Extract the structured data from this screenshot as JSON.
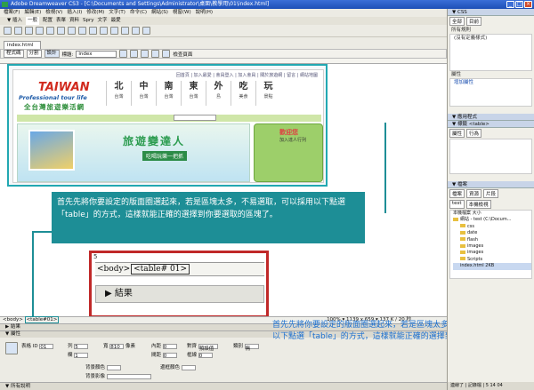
{
  "window": {
    "title": "Adobe Dreamweaver CS3 - [C:\\Documents and Settings\\Administrator\\桌面\\教學用\\01\\index.html]"
  },
  "menu": [
    "檔案(F)",
    "編輯(E)",
    "檢視(V)",
    "插入(I)",
    "修改(M)",
    "文字(T)",
    "命令(C)",
    "網站(S)",
    "視窗(W)",
    "說明(H)"
  ],
  "insert_tabs": [
    "一般",
    "配置",
    "表單",
    "資料",
    "Spry",
    "文字",
    "最愛"
  ],
  "insert_label": "▼ 插入",
  "document": {
    "tab": "index.html",
    "views": [
      "程式碼",
      "分割",
      "設計"
    ],
    "title_label": "標題:",
    "title_value": "index",
    "check_page": "檢查頁面"
  },
  "site": {
    "top_links": "回首頁 | 加入最愛 | 會員登入 | 加入會員 | 關於旅遊網 | 留言 | 網站地圖",
    "logo_en": "TAIWAN",
    "logo_sub": "Professional tour life",
    "logo_cn": "全台灣旅遊樂活網",
    "nav": [
      {
        "big": "北",
        "sm": "台灣"
      },
      {
        "big": "中",
        "sm": "台灣"
      },
      {
        "big": "南",
        "sm": "台灣"
      },
      {
        "big": "東",
        "sm": "台灣"
      },
      {
        "big": "外",
        "sm": "島"
      },
      {
        "big": "吃",
        "sm": "美食"
      },
      {
        "big": "玩",
        "sm": "景點"
      }
    ],
    "slogan": "旅遊變達人",
    "slogan_sub": "吃喝玩樂一把抓",
    "member_title": "歡迎您",
    "member_sub": "加入達人行列"
  },
  "callout": {
    "text": "首先先將你要設定的版面圈選起來，若是區塊太多，不易選取，可以採用以下點選「table」的方式，這樣就能正確的選擇到你要選取的區塊了。"
  },
  "zoom": {
    "code": "5",
    "body_tag": "<body>",
    "table_tag": "<table#     01>",
    "results": "▶ 結果"
  },
  "tag_selector": {
    "body": "<body>",
    "table": "<table#01>",
    "status": "100% ▾ 1139 x 659 ▾ 137 K / 20 秒"
  },
  "panels": {
    "results_label": "▶ 結果",
    "properties_label": "▼ 屬性",
    "table_label": "表格 ID",
    "table_id": "01",
    "rows_label": "列",
    "rows": "5",
    "cols_label": "欄",
    "cols": "1",
    "width_label": "寬",
    "width": "810",
    "unit": "像素",
    "padding_label": "內距",
    "padding": "0",
    "spacing_label": "間距",
    "spacing": "0",
    "align_label": "對齊",
    "align": "預設值",
    "border_label": "框線",
    "border": "0",
    "class_label": "類別",
    "class": "無",
    "bg_color_label": "背景顏色",
    "border_color_label": "邊框顏色",
    "bg_image_label": "背景影像",
    "help_label": "▼ 所有說明"
  },
  "right_panel": {
    "css_header": "▼ CSS",
    "css_tabs": [
      "全部",
      "目前"
    ],
    "all_rules": "所有規則",
    "no_styles": "(沒有定義樣式)",
    "properties": "屬性",
    "add_property": "增加屬性",
    "app_header": "▼ 應用程式",
    "tag_header": "▼ 標籤 <table>",
    "tag_tabs": [
      "屬性",
      "行為"
    ],
    "files_header": "▼ 檔案",
    "files_tabs": [
      "檔案",
      "資源",
      "片段"
    ],
    "site_select": "test",
    "view_select": "本機檢視",
    "local_files": "本機檔案",
    "size_col": "大小",
    "site_root": "網站 - test (C:\\Docum...",
    "folders": [
      "css",
      "date",
      "flash",
      "images",
      "images",
      "Scripts"
    ],
    "file_name": "index.html",
    "file_size": "2KB",
    "status": "連線了 | 記錄檔 | 5 14 04"
  },
  "caption": {
    "text": "首先先將你要設定的版面圈選起來，若是區塊太多，不易選取，可以採用以下點選「table」的方式，這樣就能正確的選擇到你要選取的區塊了。"
  },
  "colors": {
    "callout": "#1d8e96",
    "zoom_border": "#c02828",
    "caption": "#1a6fd0",
    "selection": "#22a8b2"
  }
}
